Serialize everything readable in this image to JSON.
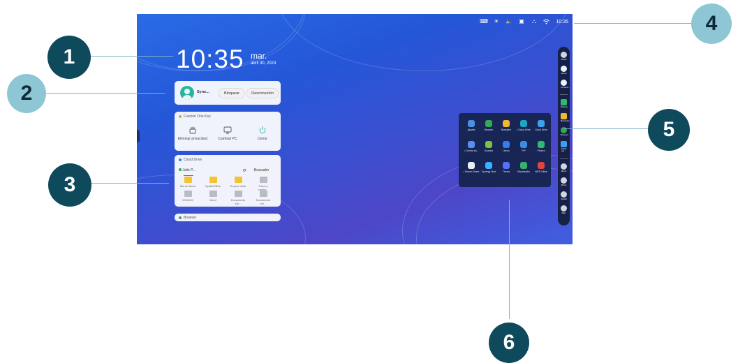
{
  "status_bar": {
    "time": "10:35"
  },
  "clock": {
    "time": "10:35",
    "weekday": "mar.",
    "date": "abril 30, 2024"
  },
  "user_card": {
    "name": "Syne...",
    "lock_label": "Bloquear",
    "logout_label": "Desconexión"
  },
  "one_key": {
    "title": "Función One Key",
    "items": [
      {
        "label": "Eliminar privacidad",
        "icon": "broom-icon"
      },
      {
        "label": "Cambiar PC",
        "icon": "monitor-icon"
      },
      {
        "label": "Cerrar",
        "icon": "power-icon"
      }
    ]
  },
  "cloud_drive": {
    "title": "Cloud Drive",
    "account": "Julie P...",
    "search_label": "Buscador",
    "files": [
      {
        "label": "Mis archivos"
      },
      {
        "label": "Syskit/Office"
      },
      {
        "label": "Grupos Visib."
      },
      {
        "label": "Fotos y contig..."
      },
      {
        "label": "02/05/24"
      },
      {
        "label": "Word"
      },
      {
        "label": "Documento sin..."
      },
      {
        "label": "Documento sin..."
      }
    ]
  },
  "browser_card": {
    "title": "Browser"
  },
  "apps": [
    {
      "label": "Ajustes",
      "color": "#4a90e2"
    },
    {
      "label": "Browser",
      "color": "#34a853"
    },
    {
      "label": "Buscador",
      "color": "#f2b632"
    },
    {
      "label": "• Cloud Drive",
      "color": "#1ea7c5"
    },
    {
      "label": "Cloud Drive",
      "color": "#3aa0f0"
    },
    {
      "label": "• Cuenta da...",
      "color": "#5b8def"
    },
    {
      "label": "Guardar",
      "color": "#7cc242"
    },
    {
      "label": "Lienzo",
      "color": "#2f80ed"
    },
    {
      "label": "PIP",
      "color": "#3c8ce6"
    },
    {
      "label": "Pizarra",
      "color": "#2eb872"
    },
    {
      "label": "• Screen Share",
      "color": "#e8eef7"
    },
    {
      "label": "Synergy Sket",
      "color": "#3ab0ff"
    },
    {
      "label": "Tienda",
      "color": "#5470ff"
    },
    {
      "label": "Visualizador",
      "color": "#38b26b"
    },
    {
      "label": "WPS Office",
      "color": "#e0443e"
    }
  ],
  "sidebar": {
    "items": [
      {
        "label": "Volver"
      },
      {
        "label": "Home"
      },
      {
        "label": "Comenz..."
      },
      {
        "label": "Pizarra"
      },
      {
        "label": "Buscador"
      },
      {
        "label": "Browser"
      },
      {
        "label": "Todas las..."
      },
      {
        "label": "Menu"
      },
      {
        "label": "Mirror"
      },
      {
        "label": "Spotlit"
      },
      {
        "label": "Más"
      }
    ]
  },
  "callouts": [
    "1",
    "2",
    "3",
    "4",
    "5",
    "6"
  ],
  "colors": {
    "callout_dark": "#0f4a5c",
    "callout_light": "#8ec6d6",
    "line": "#7fb4c7",
    "screen": "#2a5fe0"
  }
}
